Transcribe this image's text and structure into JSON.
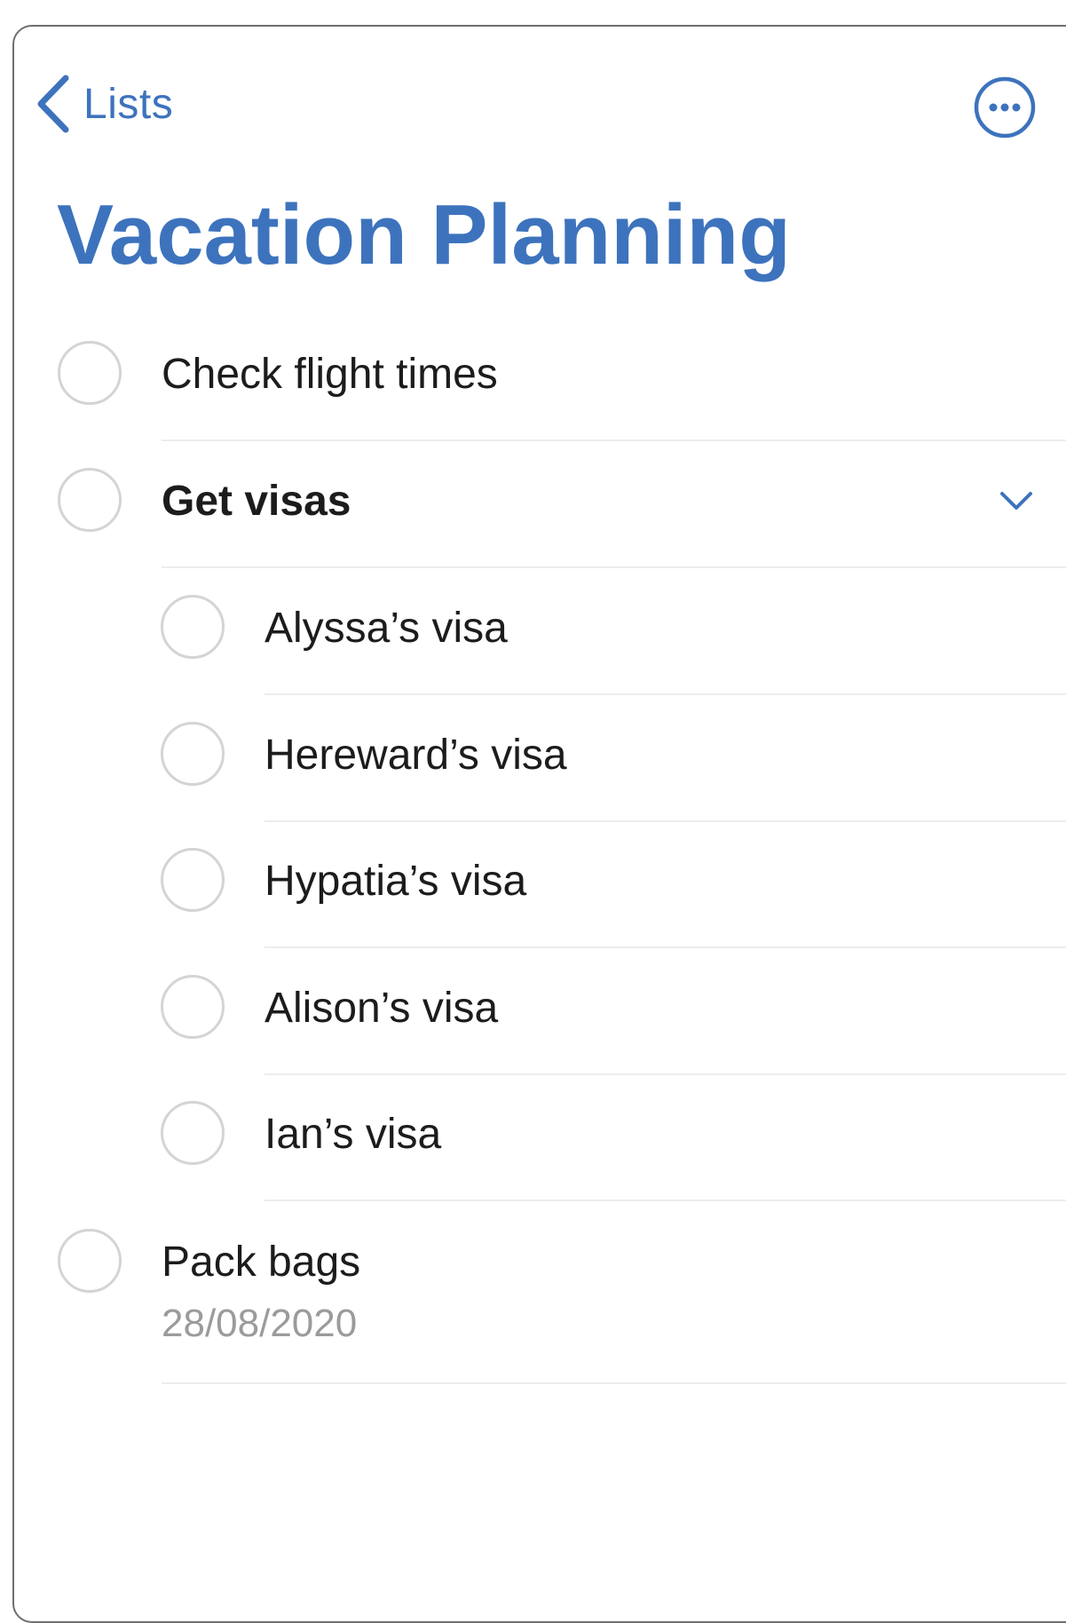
{
  "nav": {
    "back_label": "Lists"
  },
  "list": {
    "title": "Vacation Planning",
    "accent_color": "#3d73bd"
  },
  "items": [
    {
      "label": "Check flight times",
      "completed": false
    },
    {
      "label": "Get visas",
      "completed": false,
      "expanded": true,
      "subtasks": [
        {
          "label": "Alyssa’s visa",
          "completed": false
        },
        {
          "label": "Hereward’s visa",
          "completed": false
        },
        {
          "label": "Hypatia’s visa",
          "completed": false
        },
        {
          "label": "Alison’s visa",
          "completed": false
        },
        {
          "label": "Ian’s visa",
          "completed": false
        }
      ]
    },
    {
      "label": "Pack bags",
      "date": "28/08/2020",
      "completed": false
    }
  ],
  "icons": {
    "back": "chevron-left-icon",
    "more": "ellipsis-circle-icon",
    "expand": "chevron-down-icon"
  }
}
